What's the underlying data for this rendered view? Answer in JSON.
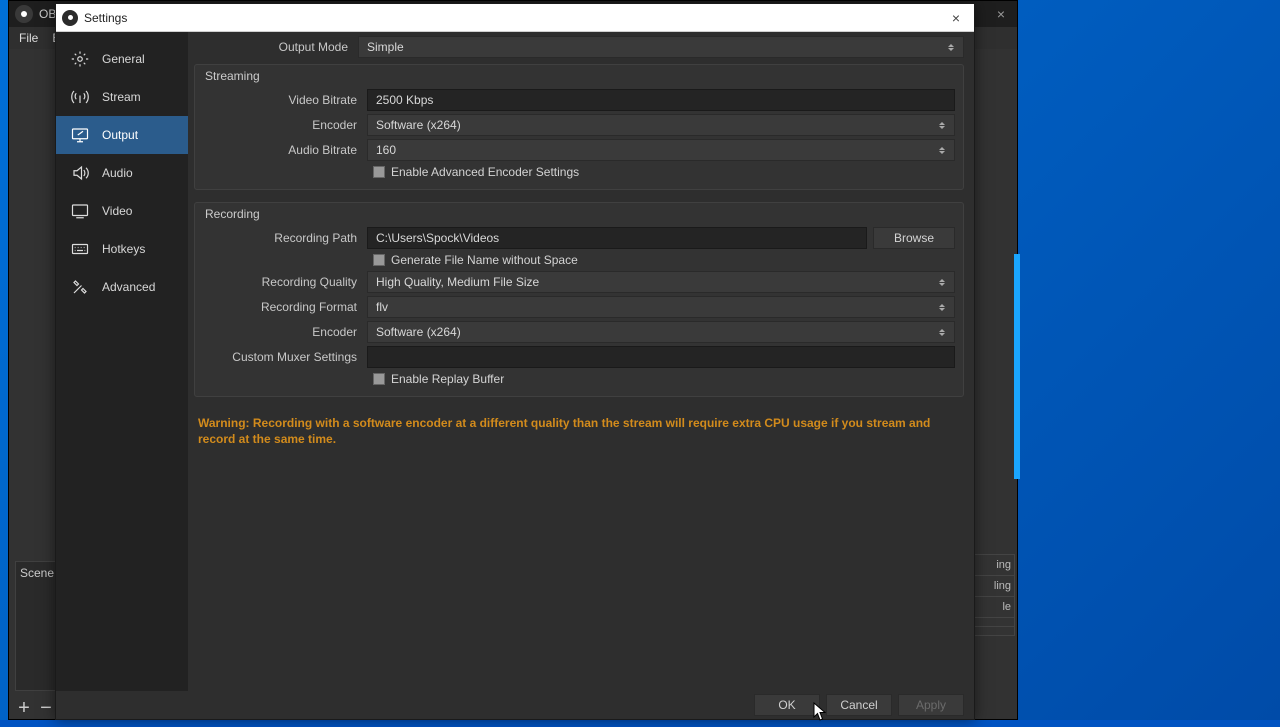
{
  "desktop": {},
  "obs": {
    "app_name": "OBS",
    "menu": {
      "file": "File",
      "edit": "E"
    },
    "scene_label": "Scene",
    "right_items": [
      "ing",
      "ling",
      "le",
      "",
      ""
    ],
    "add": "+",
    "remove": "−"
  },
  "settings": {
    "title": "Settings",
    "nav": [
      {
        "key": "general",
        "label": "General"
      },
      {
        "key": "stream",
        "label": "Stream"
      },
      {
        "key": "output",
        "label": "Output"
      },
      {
        "key": "audio",
        "label": "Audio"
      },
      {
        "key": "video",
        "label": "Video"
      },
      {
        "key": "hotkeys",
        "label": "Hotkeys"
      },
      {
        "key": "advanced",
        "label": "Advanced"
      }
    ],
    "selected_nav": "output",
    "output_mode": {
      "label": "Output Mode",
      "value": "Simple"
    },
    "streaming": {
      "title": "Streaming",
      "video_bitrate": {
        "label": "Video Bitrate",
        "value": "2500 Kbps"
      },
      "encoder": {
        "label": "Encoder",
        "value": "Software (x264)"
      },
      "audio_bitrate": {
        "label": "Audio Bitrate",
        "value": "160"
      },
      "enable_advanced": {
        "label": "Enable Advanced Encoder Settings",
        "checked": false
      }
    },
    "recording": {
      "title": "Recording",
      "path": {
        "label": "Recording Path",
        "value": "C:\\Users\\Spock\\Videos",
        "browse": "Browse"
      },
      "gen_nospace": {
        "label": "Generate File Name without Space",
        "checked": false
      },
      "quality": {
        "label": "Recording Quality",
        "value": "High Quality, Medium File Size"
      },
      "format": {
        "label": "Recording Format",
        "value": "flv"
      },
      "encoder": {
        "label": "Encoder",
        "value": "Software (x264)"
      },
      "muxer": {
        "label": "Custom Muxer Settings",
        "value": ""
      },
      "replay": {
        "label": "Enable Replay Buffer",
        "checked": false
      }
    },
    "warning": "Warning: Recording with a software encoder at a different quality than the stream will require extra CPU usage if you stream and record at the same time.",
    "buttons": {
      "ok": "OK",
      "cancel": "Cancel",
      "apply": "Apply"
    }
  }
}
